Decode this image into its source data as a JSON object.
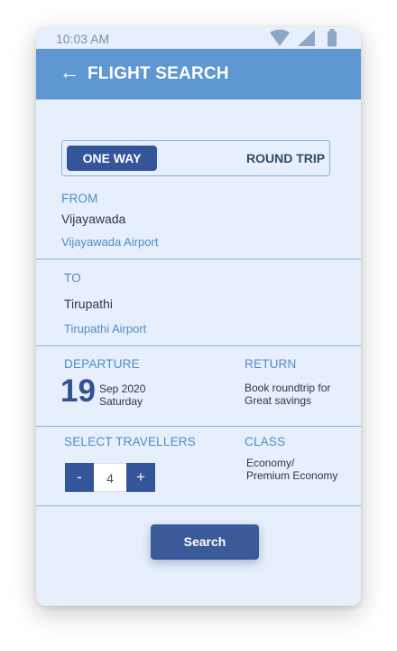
{
  "status_bar": {
    "time": "10:03 AM"
  },
  "header": {
    "title": "FLIGHT SEARCH",
    "back_icon": "back-arrow-icon"
  },
  "trip_type": {
    "options": [
      "ONE WAY",
      "ROUND TRIP"
    ],
    "selected": "ONE WAY"
  },
  "from": {
    "label": "FROM",
    "city": "Vijayawada",
    "airport": "Vijayawada Airport"
  },
  "to": {
    "label": "TO",
    "city": "Tirupathi",
    "airport": "Tirupathi Airport"
  },
  "departure": {
    "label": "DEPARTURE",
    "day": "19",
    "month_year": "Sep 2020",
    "weekday": "Saturday"
  },
  "return": {
    "label": "RETURN",
    "line1": "Book roundtrip for",
    "line2": "Great savings"
  },
  "travellers": {
    "label": "SELECT TRAVELLERS",
    "minus": "-",
    "count": "4",
    "plus": "+"
  },
  "class": {
    "label": "CLASS",
    "line1": "Economy/",
    "line2": "Premium Economy"
  },
  "search_button": {
    "label": "Search"
  },
  "colors": {
    "background": "#e6effb",
    "header": "#5e97d1",
    "primary": "#34559a",
    "label": "#4f8cc6",
    "divider": "#8ab7dc"
  }
}
